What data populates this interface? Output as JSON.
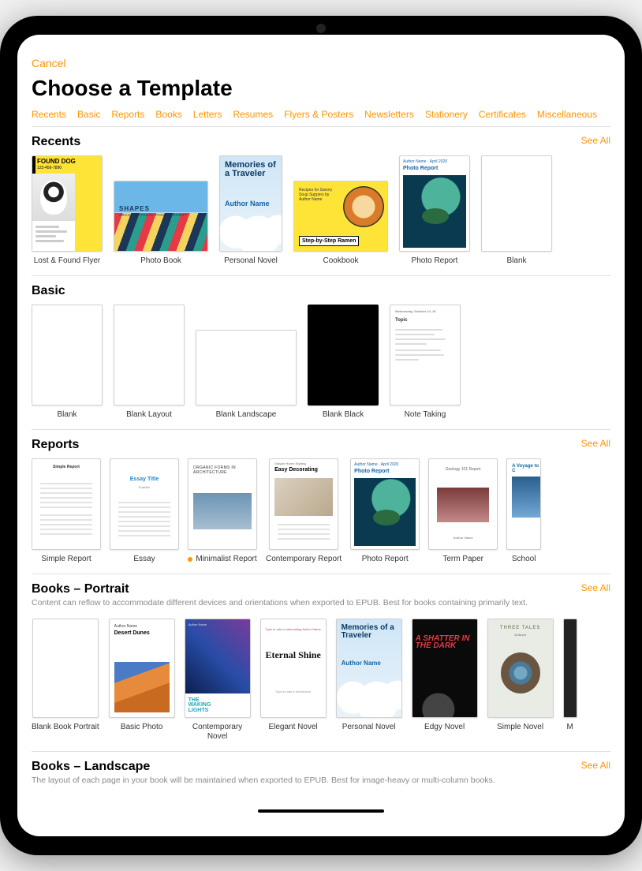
{
  "accent": "#ff9500",
  "header": {
    "cancel": "Cancel",
    "title": "Choose a Template"
  },
  "tabs": [
    "Recents",
    "Basic",
    "Reports",
    "Books",
    "Letters",
    "Resumes",
    "Flyers & Posters",
    "Newsletters",
    "Stationery",
    "Certificates",
    "Miscellaneous"
  ],
  "see_all": "See All",
  "sections": {
    "recents": {
      "title": "Recents",
      "see_all": true,
      "items": [
        {
          "label": "Lost & Found Flyer"
        },
        {
          "label": "Photo Book"
        },
        {
          "label": "Personal Novel"
        },
        {
          "label": "Cookbook"
        },
        {
          "label": "Photo Report"
        },
        {
          "label": "Blank"
        }
      ]
    },
    "basic": {
      "title": "Basic",
      "see_all": false,
      "items": [
        {
          "label": "Blank"
        },
        {
          "label": "Blank Layout"
        },
        {
          "label": "Blank Landscape"
        },
        {
          "label": "Blank Black"
        },
        {
          "label": "Note Taking"
        }
      ]
    },
    "reports": {
      "title": "Reports",
      "see_all": true,
      "items": [
        {
          "label": "Simple Report"
        },
        {
          "label": "Essay"
        },
        {
          "label": "Minimalist Report",
          "dot": true
        },
        {
          "label": "Contemporary Report"
        },
        {
          "label": "Photo Report"
        },
        {
          "label": "Term Paper"
        },
        {
          "label": "School"
        }
      ]
    },
    "books_portrait": {
      "title": "Books – Portrait",
      "see_all": true,
      "desc": "Content can reflow to accommodate different devices and orientations when exported to EPUB. Best for books containing primarily text.",
      "items": [
        {
          "label": "Blank Book Portrait"
        },
        {
          "label": "Basic Photo"
        },
        {
          "label": "Contemporary Novel"
        },
        {
          "label": "Elegant Novel"
        },
        {
          "label": "Personal Novel"
        },
        {
          "label": "Edgy Novel"
        },
        {
          "label": "Simple Novel"
        },
        {
          "label": "M"
        }
      ]
    },
    "books_landscape": {
      "title": "Books – Landscape",
      "see_all": true,
      "desc": "The layout of each page in your book will be maintained when exported to EPUB. Best for image-heavy or multi-column books."
    }
  },
  "thumb_text": {
    "found_dog_title": "FOUND DOG",
    "found_dog_phone": "123-456-7890",
    "shapes": "SHAPES",
    "shapes_sub": "ARCHITECTURAL PHOTOGRAPHY",
    "memories": "Memories of a Traveler",
    "author_name": "Author Name",
    "cookbook_small": "Recipes for Savory Soup Suppers by Author Name",
    "ramen": "Step-by-Step Ramen",
    "photo_report_hdr": "Author Name · April 2020",
    "photo_report_title": "Photo Report",
    "essay_title": "Essay Title",
    "minimal_title": "ORGANIC FORMS IN ARCHITECTURE",
    "contemp_title": "Easy Decorating",
    "contemp_sub": "Simple Home Styling",
    "term_paper_title": "Geology 101 Report",
    "school_title": "A Voyage to C",
    "dunes_author": "Author Name",
    "dunes_title": "Desert Dunes",
    "contnov_author": "Author Name",
    "contnov_title1": "THE",
    "contnov_title2": "WAKING",
    "contnov_title3": "LIGHTS",
    "elegant_top": "Type to add a subheading Author Name",
    "elegant_title": "Eternal Shine",
    "elegant_sub": "Type to add a description",
    "edgy_title": "A SHATTER IN THE DARK",
    "simple_nov_title": "THREE TALES",
    "simple_nov_sub": "A Novel"
  }
}
